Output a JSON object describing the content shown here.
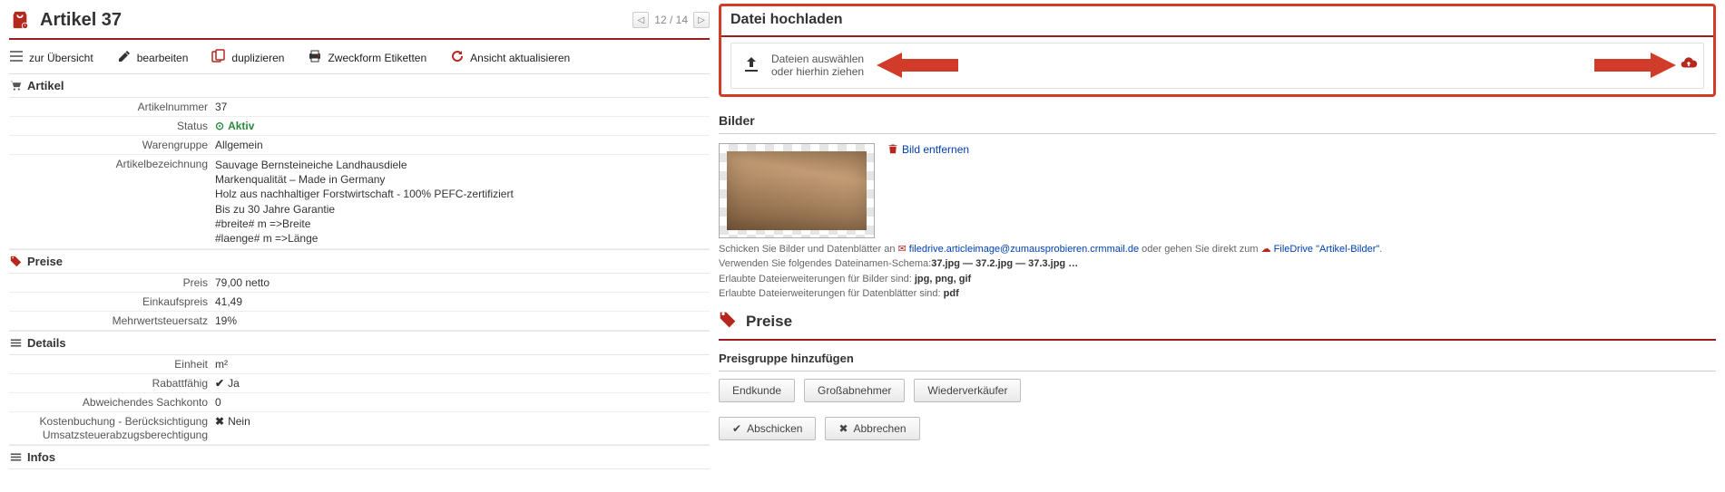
{
  "header": {
    "title": "Artikel 37",
    "pager": {
      "position": "12 / 14"
    }
  },
  "toolbar": {
    "overview": "zur Übersicht",
    "edit": "bearbeiten",
    "duplicate": "duplizieren",
    "zweckform": "Zweckform Etiketten",
    "refresh": "Ansicht aktualisieren"
  },
  "sections": {
    "artikel": "Artikel",
    "preise": "Preise",
    "details": "Details",
    "infos": "Infos"
  },
  "artikel": {
    "labels": {
      "nummer": "Artikelnummer",
      "status": "Status",
      "warengruppe": "Warengruppe",
      "bezeichnung": "Artikelbezeichnung"
    },
    "nummer": "37",
    "status": "Aktiv",
    "warengruppe": "Allgemein",
    "bezeichnung": "Sauvage Bernsteineiche Landhausdiele\nMarkenqualität – Made in Germany\nHolz aus nachhaltiger Forstwirtschaft - 100% PEFC-zertifiziert\nBis zu 30 Jahre Garantie\n#breite# m =>Breite\n#laenge# m =>Länge"
  },
  "preise": {
    "labels": {
      "preis": "Preis",
      "einkauf": "Einkaufspreis",
      "mwst": "Mehrwertsteuersatz"
    },
    "preis": "79,00 netto",
    "einkauf": "41,49",
    "mwst": "19%"
  },
  "details": {
    "labels": {
      "einheit": "Einheit",
      "rabatt": "Rabattfähig",
      "sachkonto": "Abweichendes Sachkonto",
      "kostenbuchung": "Kostenbuchung - Berücksichtigung Umsatzsteuerabzugsberechtigung"
    },
    "einheit": "m²",
    "rabatt": "Ja",
    "sachkonto": "0",
    "kostenbuchung": "Nein"
  },
  "upload": {
    "title": "Datei hochladen",
    "line1": "Dateien auswählen",
    "line2": "oder hierhin ziehen"
  },
  "bilder": {
    "title": "Bilder",
    "remove": "Bild entfernen",
    "hint_prefix": "Schicken Sie Bilder und Datenblätter an ",
    "email": "filedrive.articleimage@zumausprobieren.crmmail.de",
    "hint_mid": " oder gehen Sie direkt zum ",
    "filedrive": "FileDrive \"Artikel-Bilder\"",
    "hint_suffix": ".",
    "schema_prefix": "Verwenden Sie folgendes Dateinamen-Schema:",
    "schema": "37.jpg — 37.2.jpg — 37.3.jpg …",
    "ext_img_prefix": "Erlaubte Dateierweiterungen für Bilder sind: ",
    "ext_img": "jpg, png, gif",
    "ext_pdf_prefix": "Erlaubte Dateierweiterungen für Datenblätter sind: ",
    "ext_pdf": "pdf"
  },
  "preise_right": {
    "title": "Preise",
    "subtitle": "Preisgruppe hinzufügen",
    "buttons": {
      "endkunde": "Endkunde",
      "gross": "Großabnehmer",
      "wieder": "Wiederverkäufer",
      "submit": "Abschicken",
      "cancel": "Abbrechen"
    }
  }
}
